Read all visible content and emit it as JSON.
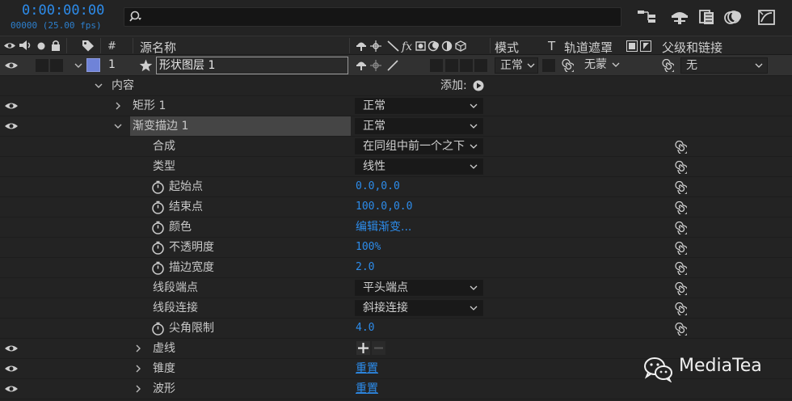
{
  "timecode": "0:00:00:00",
  "fps_label": "00000 (25.00 fps)",
  "search": {
    "placeholder": "",
    "value": ""
  },
  "header": {
    "num": "#",
    "source_name": "源名称",
    "mode": "模式",
    "t": "T",
    "track_matte": "轨道遮罩",
    "parent": "父级和链接"
  },
  "layer": {
    "number": "1",
    "name": "形状图层 1",
    "label_color": "#6f83d8",
    "mode": "正常",
    "matte": "无蒙",
    "parent": "无"
  },
  "contents": {
    "label": "内容",
    "add_label": "添加:"
  },
  "rows": [
    {
      "name": "矩形 1",
      "value": "正常"
    },
    {
      "name": "渐变描边 1",
      "value": "正常"
    },
    {
      "name": "合成",
      "value": "在同组中前一个之下"
    },
    {
      "name": "类型",
      "value": "线性"
    },
    {
      "name": "起始点",
      "value": "0.0,0.0"
    },
    {
      "name": "结束点",
      "value": "100.0,0.0"
    },
    {
      "name": "颜色",
      "value": "编辑渐变..."
    },
    {
      "name": "不透明度",
      "value": "100%"
    },
    {
      "name": "描边宽度",
      "value": "2.0"
    },
    {
      "name": "线段端点",
      "value": "平头端点"
    },
    {
      "name": "线段连接",
      "value": "斜接连接"
    },
    {
      "name": "尖角限制",
      "value": "4.0"
    },
    {
      "name": "虚线",
      "value": ""
    },
    {
      "name": "锥度",
      "value": "重置"
    },
    {
      "name": "波形",
      "value": "重置"
    }
  ],
  "watermark": "MediaTea",
  "colors": {
    "accent": "#2d8ceb",
    "bg": "#232323",
    "selected": "#454545"
  }
}
